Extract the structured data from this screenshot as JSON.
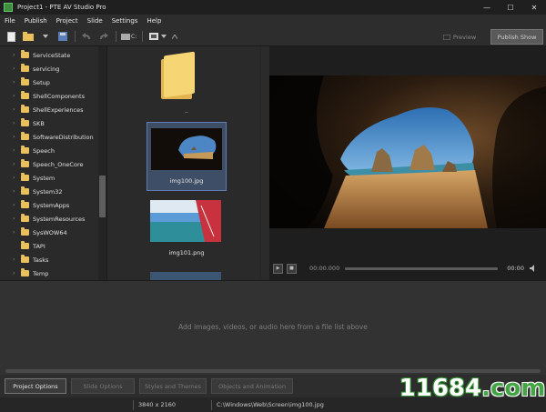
{
  "window": {
    "title": "Project1 - PTE AV Studio Pro",
    "controls": [
      "—",
      "☐",
      "✕"
    ]
  },
  "menu": [
    "File",
    "Publish",
    "Project",
    "Slide",
    "Settings",
    "Help"
  ],
  "toolbar": {
    "preview_label": "Preview",
    "publish_label": "Publish Show",
    "drive_label": "C:"
  },
  "folder_tree": [
    "ServiceState",
    "servicing",
    "Setup",
    "ShellComponents",
    "ShellExperiences",
    "SKB",
    "SoftwareDistribution",
    "Speech",
    "Speech_OneCore",
    "System",
    "System32",
    "SystemApps",
    "SystemResources",
    "SysWOW64",
    "TAPI",
    "Tasks",
    "Temp"
  ],
  "file_list": {
    "parent_folder_label": "..",
    "items": [
      {
        "name": "img100.jpg",
        "selected": true
      },
      {
        "name": "img101.png",
        "selected": false
      }
    ]
  },
  "player": {
    "time_current": "00:00.000",
    "time_total": "00:00"
  },
  "timeline": {
    "hint": "Add images, videos, or audio here from a file list above"
  },
  "bottom_tabs": [
    {
      "label": "Project Options",
      "active": true
    },
    {
      "label": "Slide Options",
      "active": false
    },
    {
      "label": "Styles and Themes",
      "active": false
    },
    {
      "label": "Objects and Animation",
      "active": false
    }
  ],
  "status": {
    "resolution": "3840 x 2160",
    "path": "C:\\Windows\\Web\\Screen\\img100.jpg"
  },
  "watermark": {
    "text_left": "11684",
    "text_right": ".com"
  },
  "colors": {
    "accent_green": "#43a543",
    "folder_yellow": "#e8c15d",
    "selection_blue": "#3e4e66"
  }
}
